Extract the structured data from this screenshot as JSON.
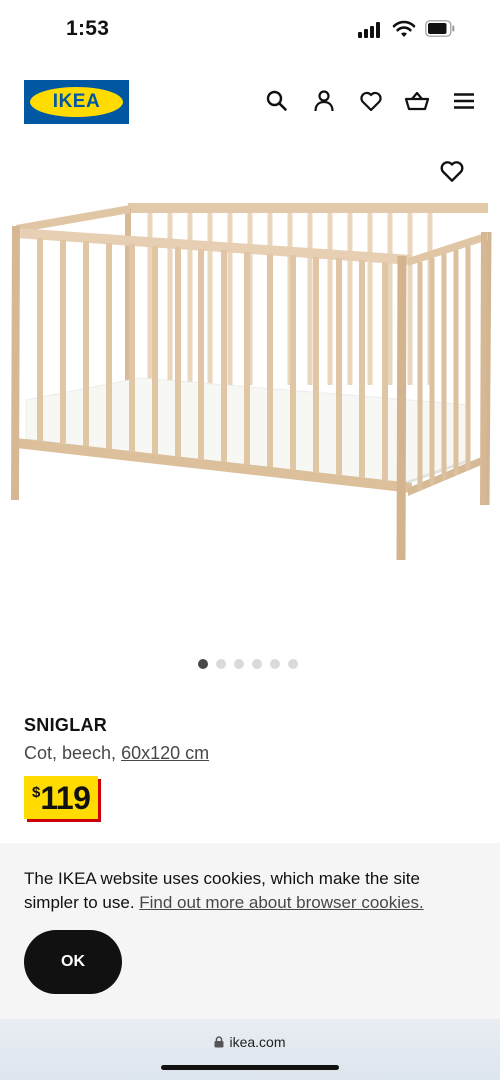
{
  "status_bar": {
    "time": "1:53"
  },
  "header": {
    "logo_text": "IKEA",
    "icons": [
      "search-icon",
      "user-icon",
      "heart-icon",
      "basket-icon",
      "menu-icon"
    ]
  },
  "product": {
    "name": "SNIGLAR",
    "description": "Cot, beech, ",
    "size": "60x120 cm",
    "price_currency": "$",
    "price_value": "119",
    "image_dots": {
      "count": 6,
      "active": 1
    }
  },
  "cookie_banner": {
    "text": "The IKEA website uses cookies, which make the site simpler to use. ",
    "link": "Find out more about browser cookies.",
    "ok_label": "OK"
  },
  "browser": {
    "url": "ikea.com"
  },
  "colors": {
    "ikea_blue": "#0058a3",
    "ikea_yellow": "#ffdb00",
    "price_red": "#cc0008"
  }
}
